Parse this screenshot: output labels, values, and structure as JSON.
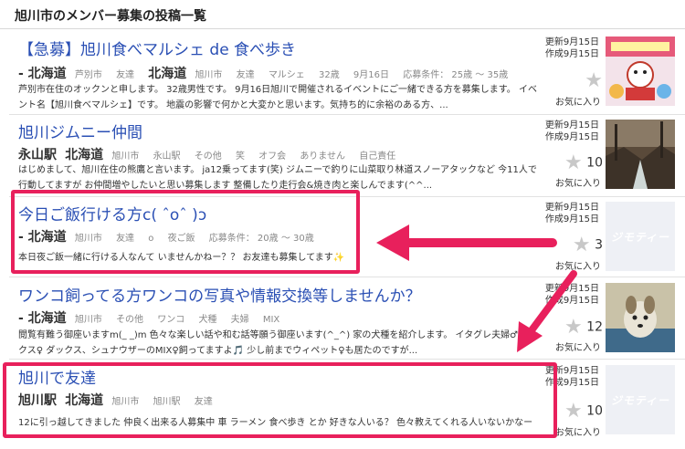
{
  "page": {
    "title": "旭川市のメンバー募集の投稿一覧"
  },
  "posts": [
    {
      "title": "【急募】旭川食べマルシェ de 食べ歩き",
      "meta_big_1": "- 北海道",
      "meta_1": "芦別市",
      "meta_2": "友達",
      "meta_big_2": "北海道",
      "meta_3": "旭川市",
      "meta_4": "友達",
      "meta_5": "マルシェ",
      "meta_6": "32歳",
      "meta_7": "9月16日",
      "meta_8": "応募条件： 25歳 〜 35歳",
      "desc": "芦別市在住のオックンと申します。 32歳男性です。 9月16日旭川で開催されるイベントにご一緒できる方を募集します。 イベント名【旭川食べマルシェ】です。 地震の影響で何かと大変かと思います。気持ち的に余裕のある方、...",
      "updated": "更新9月15日",
      "created": "作成9月15日",
      "star_count": "",
      "fav": "お気に入り"
    },
    {
      "title": "旭川ジムニー仲間",
      "meta_big_1": "永山駅",
      "meta_big_2": "北海道",
      "meta_1": "旭川市",
      "meta_2": "永山駅",
      "meta_3": "その他",
      "meta_4": "笑",
      "meta_5": "オフ会",
      "meta_6": "ありません",
      "meta_7": "自己責任",
      "desc": "はじめまして、旭川在住の熊鷹と言います。 ja12乗ってます(笑) ジムニーで釣りに山菜取り林道スノーアタックなど 今11人で行動してますが お仲間増やしたいと思い募集します 整備したり走行会&焼き肉と楽しんでます(^^...",
      "updated": "更新9月15日",
      "created": "作成9月15日",
      "star_count": "10",
      "fav": "お気に入り"
    },
    {
      "title": "今日ご飯行ける方c( ˆoˆ )ɔ",
      "meta_big_1": "- 北海道",
      "meta_1": "旭川市",
      "meta_2": "友達",
      "meta_3": "o",
      "meta_4": "夜ご飯",
      "meta_5": "応募条件： 20歳 〜 30歳",
      "desc": "本日夜ご飯一緒に行ける人なんて いませんかねー？？ お友達も募集してます✨",
      "updated": "更新9月15日",
      "created": "作成9月15日",
      "star_count": "3",
      "fav": "お気に入り",
      "thumb_text": "ジモティー"
    },
    {
      "title": "ワンコ飼ってる方ワンコの写真や情報交換等しませんか？",
      "meta_big_1": "- 北海道",
      "meta_1": "旭川市",
      "meta_2": "その他",
      "meta_3": "ワンコ",
      "meta_4": "犬種",
      "meta_5": "夫婦",
      "meta_6": "MIX",
      "desc": "閲覧有難う御座いますm(_ _)m 色々な楽しい話や和む話等願う御座います(^_^) 家の犬種を紹介します。 イタグレ夫婦♂ ミックス♀ ダックス、シュナウザーのMIX♀飼ってますよ🎵 少し前までウィペット♀も居たのですが...",
      "updated": "更新9月15日",
      "created": "作成9月15日",
      "star_count": "12",
      "fav": "お気に入り"
    },
    {
      "title": "旭川で友達",
      "meta_big_1": "旭川駅",
      "meta_big_2": "北海道",
      "meta_1": "旭川市",
      "meta_2": "旭川駅",
      "meta_3": "友達",
      "desc": "12に引っ越してきました 仲良く出来る人募集中 車 ラーメン 食べ歩き とか 好きな人いる？ 色々教えてくれる人いないかなー",
      "updated": "更新9月15日",
      "created": "作成9月15日",
      "star_count": "10",
      "fav": "お気に入り",
      "thumb_text": "ジモティー"
    }
  ],
  "colors": {
    "link": "#2a4fb4",
    "highlight": "#e8205c",
    "star": "#c8c8c8"
  }
}
